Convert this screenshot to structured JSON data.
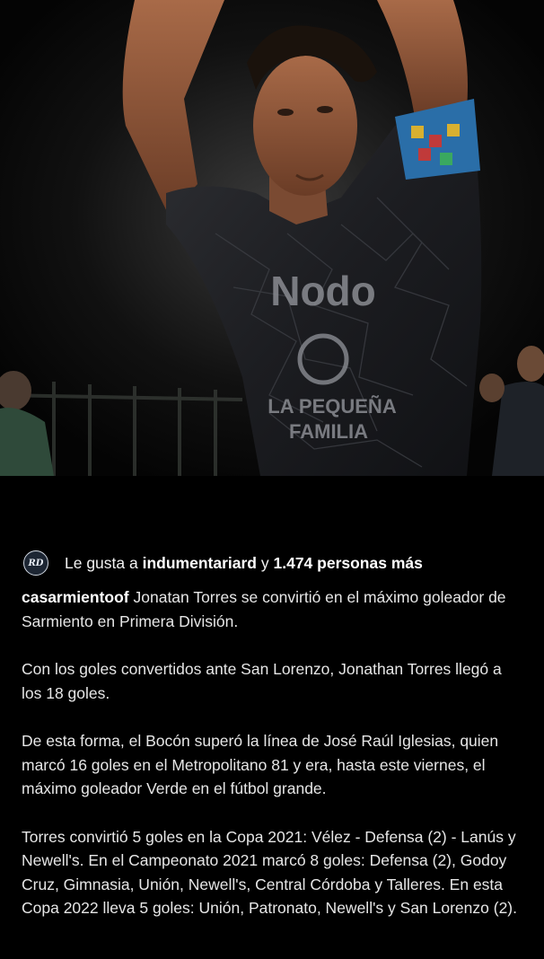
{
  "photo": {
    "description_icon": "player-photo",
    "jersey_sponsor": "Nodo",
    "jersey_text_line1": "LA PEQUEÑA",
    "jersey_text_line2": "FAMILIA"
  },
  "likes": {
    "avatar_initials": "RD",
    "prefix": "Le gusta a",
    "user": "indumentariard",
    "connector": "y",
    "others": "1.474 personas más"
  },
  "post": {
    "username": "casarmientoof",
    "paragraphs": [
      "Jonatan Torres se convirtió en el máximo goleador de Sarmiento en Primera División.",
      "Con los goles convertidos ante San Lorenzo, Jonathan Torres llegó a los 18 goles.",
      "De esta forma, el Bocón superó la línea de José Raúl Iglesias, quien marcó 16 goles en el Metropolitano 81 y era, hasta este viernes, el máximo goleador Verde en el fútbol grande.",
      "Torres convirtió 5 goles en la Copa 2021: Vélez - Defensa (2) - Lanús y Newell's. En el Campeonato 2021 marcó 8 goles: Defensa (2), Godoy Cruz, Gimnasia, Unión, Newell's, Central Córdoba y Talleres. En esta Copa 2022 lleva 5 goles: Unión, Patronato, Newell's y San Lorenzo (2)."
    ]
  }
}
